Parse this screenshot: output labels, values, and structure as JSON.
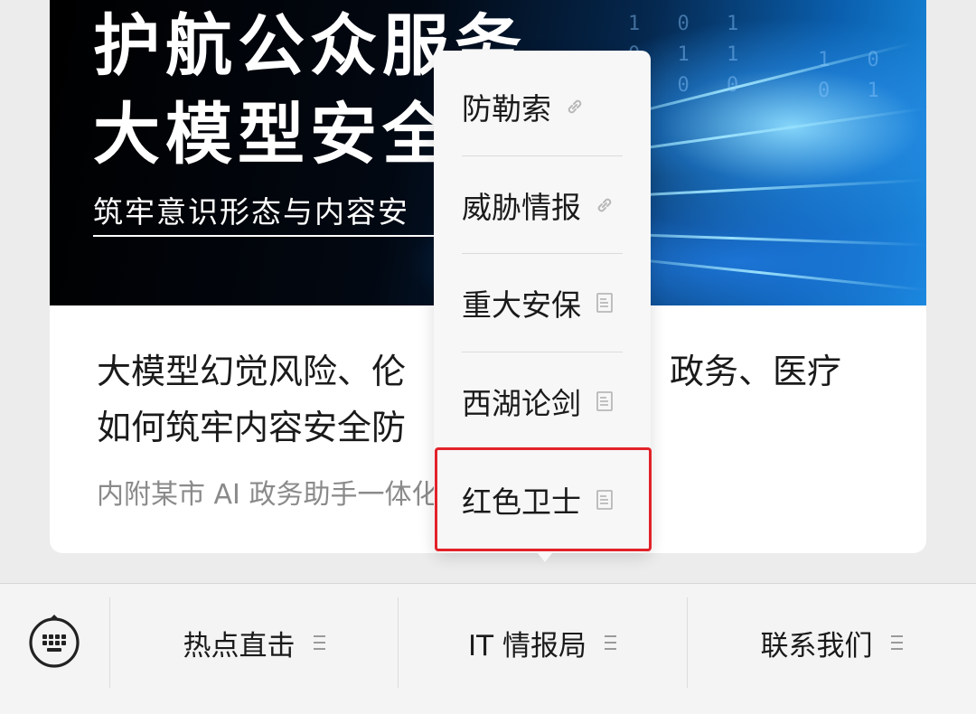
{
  "article": {
    "banner_line1": "护航公众服务",
    "banner_line2": "大模型安全",
    "banner_subtitle": "筑牢意识形态与内容安",
    "title_line1": "大模型幻觉风险、伦",
    "title_line1_end": "政务、医疗",
    "title_line2": "如何筑牢内容安全防",
    "description": "内附某市 AI 政务助手一体化"
  },
  "popup_menu": {
    "items": [
      {
        "label": "防勒索",
        "icon": "link-icon"
      },
      {
        "label": "威胁情报",
        "icon": "link-icon"
      },
      {
        "label": "重大安保",
        "icon": "page-icon"
      },
      {
        "label": "西湖论剑",
        "icon": "page-icon"
      },
      {
        "label": "红色卫士",
        "icon": "page-icon"
      }
    ],
    "highlighted": "红色卫士",
    "highlight_color": "#e2222a"
  },
  "bottom_bar": {
    "keyboard_icon": "keyboard-icon",
    "tabs": [
      {
        "label": "热点直击",
        "icon": "menu-lines-icon"
      },
      {
        "label": "IT 情报局",
        "icon": "menu-lines-icon"
      },
      {
        "label": "联系我们",
        "icon": "menu-lines-icon"
      }
    ]
  }
}
